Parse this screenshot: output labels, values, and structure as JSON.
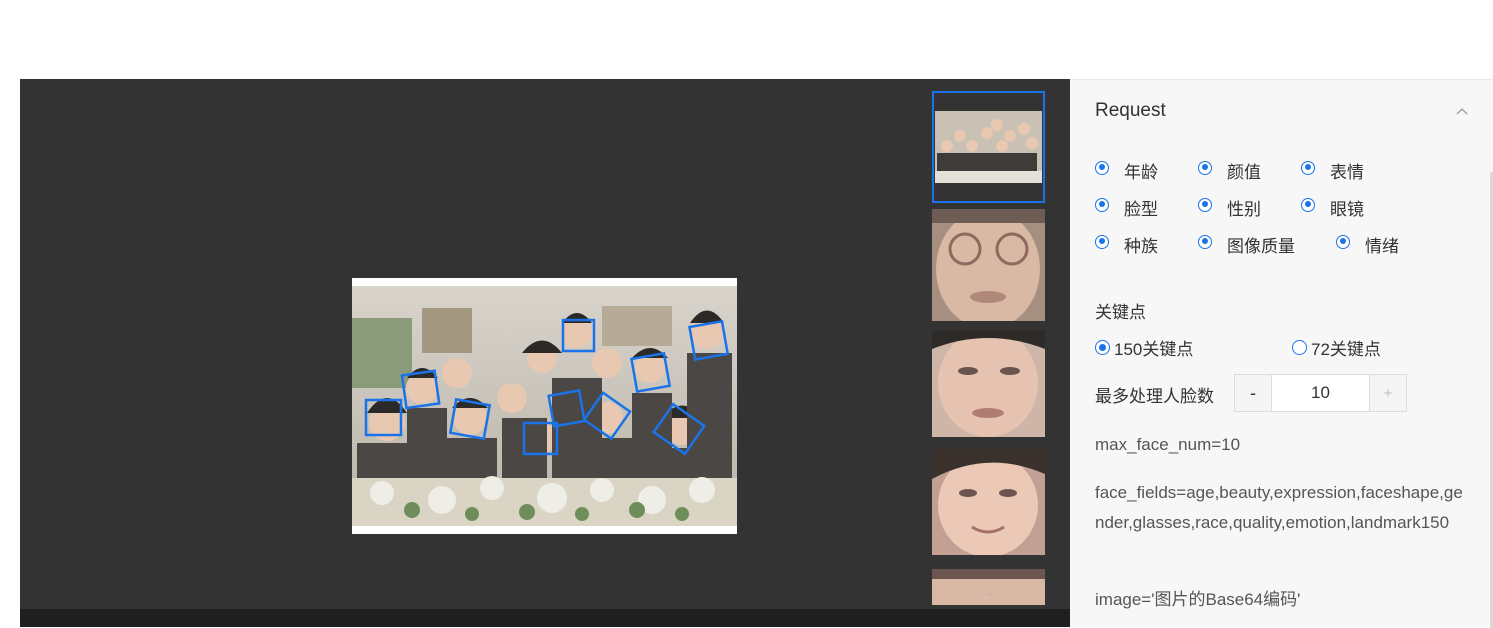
{
  "request_panel": {
    "title": "Request",
    "collapse_icon": "chevron-up-icon",
    "face_fields": [
      {
        "label": "年龄",
        "checked": true
      },
      {
        "label": "颜值",
        "checked": true
      },
      {
        "label": "表情",
        "checked": true
      },
      {
        "label": "脸型",
        "checked": true
      },
      {
        "label": "性别",
        "checked": true
      },
      {
        "label": "眼镜",
        "checked": true
      },
      {
        "label": "种族",
        "checked": true
      },
      {
        "label": "图像质量",
        "checked": true
      },
      {
        "label": "情绪",
        "checked": true
      }
    ],
    "landmark_section_label": "关键点",
    "landmark_options": [
      {
        "label": "150关键点",
        "selected": true
      },
      {
        "label": "72关键点",
        "selected": false
      }
    ],
    "max_face_label": "最多处理人脸数",
    "stepper": {
      "minus": "-",
      "value": "10",
      "plus": "+"
    },
    "params": {
      "max_face_num": "max_face_num=10",
      "face_fields": "face_fields=age,beauty,expression,faceshape,gender,glasses,race,quality,emotion,landmark150",
      "image": "image='图片的Base64编码'"
    }
  },
  "viewer": {
    "detected_faces_count": 11,
    "thumbnail_count": 5,
    "selected_thumbnail_index": 0,
    "scroll_icon": "chevron-down-icon",
    "accent_color": "#1a73e8"
  }
}
